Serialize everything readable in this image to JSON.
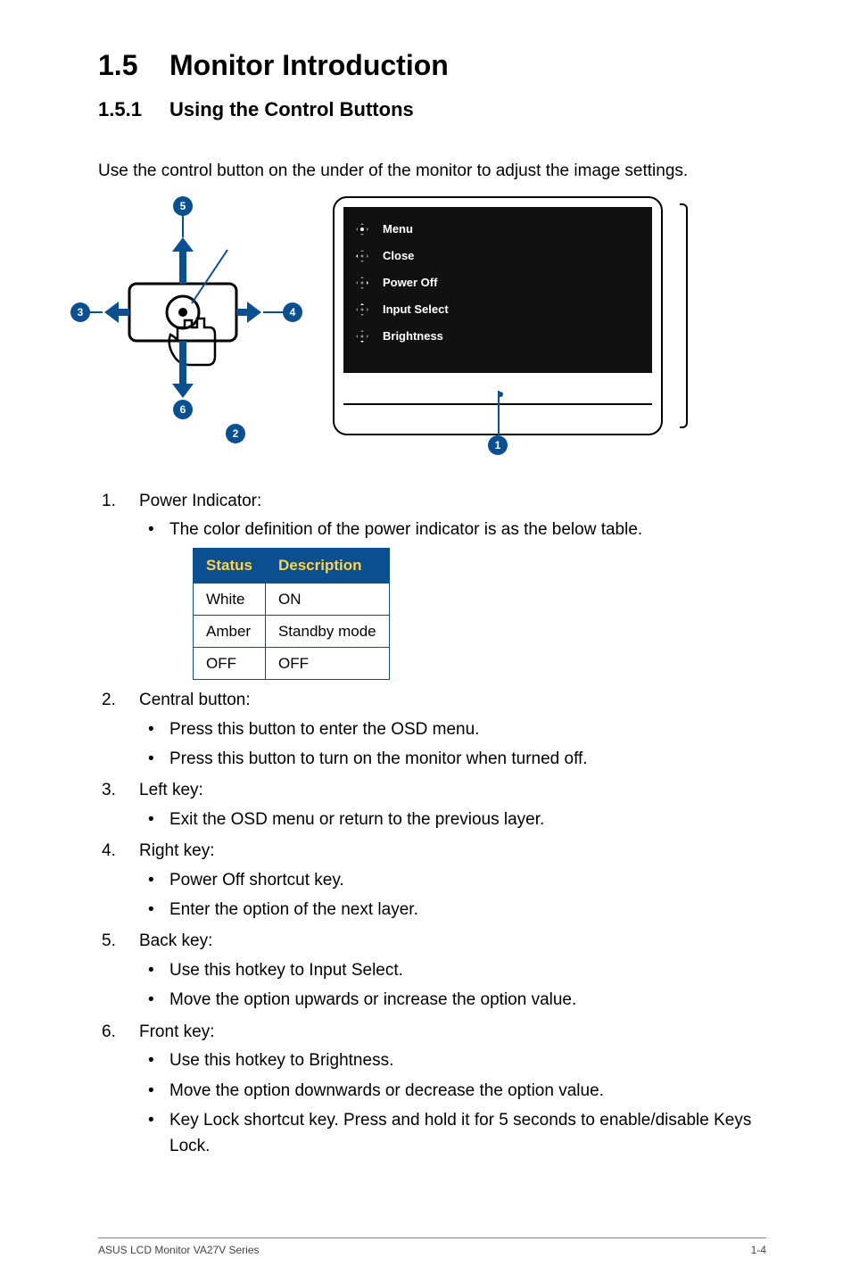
{
  "heading": {
    "num": "1.5",
    "title": "Monitor Introduction"
  },
  "sub": {
    "num": "1.5.1",
    "title": "Using the Control Buttons"
  },
  "intro": "Use the control button on the under of the monitor to adjust the image settings.",
  "callouts": {
    "c1": "1",
    "c2": "2",
    "c3": "3",
    "c4": "4",
    "c5": "5",
    "c6": "6"
  },
  "osd": {
    "menu": "Menu",
    "close": "Close",
    "poweroff": "Power Off",
    "input": "Input Select",
    "bright": "Brightness"
  },
  "list": {
    "i1": {
      "title": "Power Indicator:",
      "b1": "The color definition of the power indicator is as the below table."
    },
    "i2": {
      "title": "Central button:",
      "b1": "Press this button to enter the OSD menu.",
      "b2": "Press this button to turn on the monitor when turned off."
    },
    "i3": {
      "title": "Left key:",
      "b1": "Exit the OSD menu or return to the previous layer."
    },
    "i4": {
      "title": "Right key:",
      "b1": "Power Off shortcut key.",
      "b2": "Enter the option of the next layer."
    },
    "i5": {
      "title": "Back key:",
      "b1": "Use this hotkey to Input Select.",
      "b2": "Move the option upwards or increase the option value."
    },
    "i6": {
      "title": "Front key:",
      "b1": "Use this hotkey to Brightness.",
      "b2": "Move the option downwards or decrease the option value.",
      "b3": "Key Lock shortcut key. Press and hold it for 5 seconds to enable/disable Keys Lock."
    }
  },
  "table": {
    "h1": "Status",
    "h2": "Description",
    "r1c1": "White",
    "r1c2": "ON",
    "r2c1": "Amber",
    "r2c2": "Standby mode",
    "r3c1": "OFF",
    "r3c2": "OFF"
  },
  "footer": {
    "left": "ASUS LCD Monitor VA27V Series",
    "right": "1-4"
  }
}
